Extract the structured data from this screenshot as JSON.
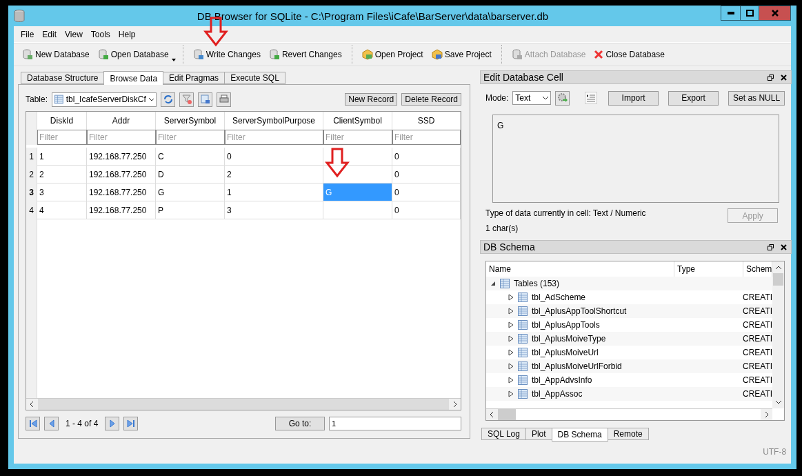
{
  "window": {
    "title": "DB Browser for SQLite - C:\\Program Files\\iCafe\\BarServer\\data\\barserver.db"
  },
  "menu": [
    "File",
    "Edit",
    "View",
    "Tools",
    "Help"
  ],
  "toolbar": [
    {
      "label": "New Database",
      "kind": "new",
      "disabled": false,
      "dropdown": false,
      "separator_after": false
    },
    {
      "label": "Open Database",
      "kind": "open",
      "disabled": false,
      "dropdown": true,
      "separator_after": true
    },
    {
      "label": "Write Changes",
      "kind": "write",
      "disabled": false,
      "dropdown": false,
      "separator_after": false
    },
    {
      "label": "Revert Changes",
      "kind": "revert",
      "disabled": false,
      "dropdown": false,
      "separator_after": true
    },
    {
      "label": "Open Project",
      "kind": "project-open",
      "disabled": false,
      "dropdown": false,
      "separator_after": false
    },
    {
      "label": "Save Project",
      "kind": "project-save",
      "disabled": false,
      "dropdown": false,
      "separator_after": true
    },
    {
      "label": "Attach Database",
      "kind": "attach",
      "disabled": true,
      "dropdown": false,
      "separator_after": false
    },
    {
      "label": "Close Database",
      "kind": "close",
      "disabled": false,
      "dropdown": false,
      "separator_after": false
    }
  ],
  "tabs": [
    {
      "label": "Database Structure",
      "selected": false
    },
    {
      "label": "Browse Data",
      "selected": true
    },
    {
      "label": "Edit Pragmas",
      "selected": false
    },
    {
      "label": "Execute SQL",
      "selected": false
    }
  ],
  "browse": {
    "table_label": "Table:",
    "table_value": "tbl_IcafeServerDiskCf",
    "new_record": "New Record",
    "delete_record": "Delete Record",
    "columns": [
      {
        "name": "DiskId",
        "placeholder": "Filter"
      },
      {
        "name": "Addr",
        "placeholder": "Filter"
      },
      {
        "name": "ServerSymbol",
        "placeholder": "Filter"
      },
      {
        "name": "ServerSymbolPurpose",
        "placeholder": "Filter"
      },
      {
        "name": "ClientSymbol",
        "placeholder": "Filter"
      },
      {
        "name": "SSD",
        "placeholder": "Filter"
      }
    ],
    "rows": [
      {
        "number": "1",
        "current": false,
        "cells": [
          {
            "text": "1",
            "selected": false
          },
          {
            "text": "192.168.77.250",
            "selected": false
          },
          {
            "text": "C",
            "selected": false
          },
          {
            "text": "0",
            "selected": false
          },
          {
            "selected": false
          },
          {
            "text": "0",
            "selected": false
          }
        ]
      },
      {
        "number": "2",
        "current": false,
        "cells": [
          {
            "text": "2",
            "selected": false
          },
          {
            "text": "192.168.77.250",
            "selected": false
          },
          {
            "text": "D",
            "selected": false
          },
          {
            "text": "2",
            "selected": false
          },
          {
            "selected": false
          },
          {
            "text": "0",
            "selected": false
          }
        ]
      },
      {
        "number": "3",
        "current": true,
        "cells": [
          {
            "text": "3",
            "selected": false
          },
          {
            "text": "192.168.77.250",
            "selected": false
          },
          {
            "text": "G",
            "selected": false
          },
          {
            "text": "1",
            "selected": false
          },
          {
            "text": "G",
            "selected": true
          },
          {
            "text": "0",
            "selected": false
          }
        ]
      },
      {
        "number": "4",
        "current": false,
        "cells": [
          {
            "text": "4",
            "selected": false
          },
          {
            "text": "192.168.77.250",
            "selected": false
          },
          {
            "text": "P",
            "selected": false
          },
          {
            "text": "3",
            "selected": false
          },
          {
            "selected": false
          },
          {
            "text": "0",
            "selected": false
          }
        ]
      }
    ],
    "pager": "1 - 4 of 4",
    "goto_button": "Go to:",
    "goto_value": "1"
  },
  "edit_cell": {
    "title": "Edit Database Cell",
    "mode_label": "Mode:",
    "mode_value": "Text",
    "buttons": [
      "Import",
      "Export",
      "Set as NULL"
    ],
    "content": "G",
    "type_info": "Type of data currently in cell: Text / Numeric",
    "size_info": "1 char(s)",
    "apply": {
      "label": "Apply",
      "disabled": true
    }
  },
  "schema": {
    "title": "DB Schema",
    "columns": [
      "Name",
      "Type",
      "Schem"
    ],
    "tree": [
      {
        "name": "Tables (153)",
        "expanded": true,
        "children": [
          {
            "name": "tbl_AdScheme",
            "schema": "CREATI",
            "expanded": false
          },
          {
            "name": "tbl_AplusAppToolShortcut",
            "schema": "CREATI",
            "expanded": false
          },
          {
            "name": "tbl_AplusAppTools",
            "schema": "CREATI",
            "expanded": false
          },
          {
            "name": "tbl_AplusMoiveType",
            "schema": "CREATI",
            "expanded": false
          },
          {
            "name": "tbl_AplusMoiveUrl",
            "schema": "CREATI",
            "expanded": false
          },
          {
            "name": "tbl_AplusMoiveUrlForbid",
            "schema": "CREATI",
            "expanded": false
          },
          {
            "name": "tbl_AppAdvsInfo",
            "schema": "CREATI",
            "expanded": false
          },
          {
            "name": "tbl_AppAssoc",
            "schema": "CREATI",
            "expanded": false
          }
        ]
      }
    ]
  },
  "bottom_tabs": [
    {
      "label": "SQL Log",
      "selected": false
    },
    {
      "label": "Plot",
      "selected": false
    },
    {
      "label": "DB Schema",
      "selected": true
    },
    {
      "label": "Remote",
      "selected": false
    }
  ],
  "status_bar": {
    "encoding": "UTF-8"
  }
}
